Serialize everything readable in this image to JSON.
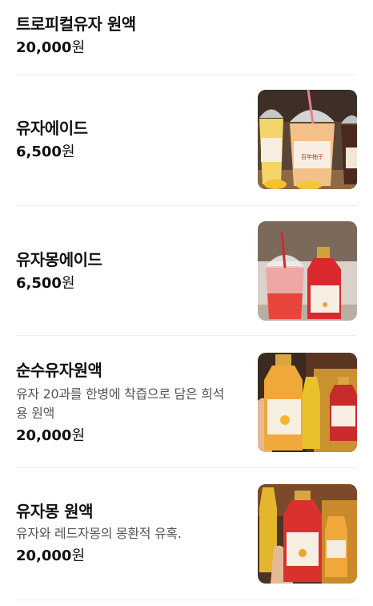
{
  "currency_unit": "원",
  "items": [
    {
      "name": "트로피컬유자 원액",
      "price": "20,000",
      "description": "",
      "image": "none"
    },
    {
      "name": "유자에이드",
      "price": "6,500",
      "description": "",
      "image": "photo-yuja-ade-cups",
      "cup_label": "百年柚子"
    },
    {
      "name": "유자몽에이드",
      "price": "6,500",
      "description": "",
      "image": "photo-yujamong-ade-bottle"
    },
    {
      "name": "순수유자원액",
      "price": "20,000",
      "description": "유자 20과를 한병에 착즙으로 담은 희석용 원액",
      "image": "photo-yuja-concentrate-bottles"
    },
    {
      "name": "유자몽 원액",
      "price": "20,000",
      "description": "유자와 레드자몽의 몽환적 유혹.",
      "image": "photo-yujamong-concentrate-bottle"
    }
  ],
  "colors": {
    "text": "#111111",
    "description": "#555555",
    "divider": "#eeeeee"
  }
}
